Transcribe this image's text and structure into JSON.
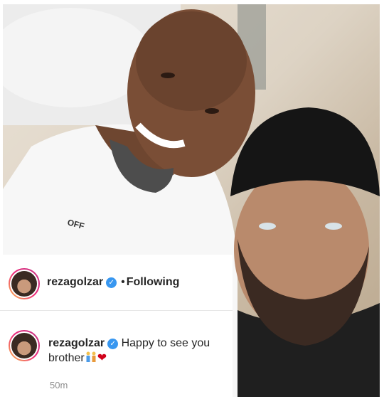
{
  "post": {
    "image_alt": "Selfie photo",
    "header": {
      "username": "rezagolzar",
      "verified_icon": "verified-badge-icon",
      "separator": "•",
      "follow_status": "Following"
    },
    "comment": {
      "username": "rezagolzar",
      "text": "Happy to see you brother",
      "emoji_icons": [
        "couple-emoji-icon",
        "red-heart-icon"
      ],
      "time": "50m"
    }
  },
  "colors": {
    "verified": "#3897f0",
    "text": "#262626",
    "muted": "#8e8e8e",
    "heart": "#d0021b"
  }
}
